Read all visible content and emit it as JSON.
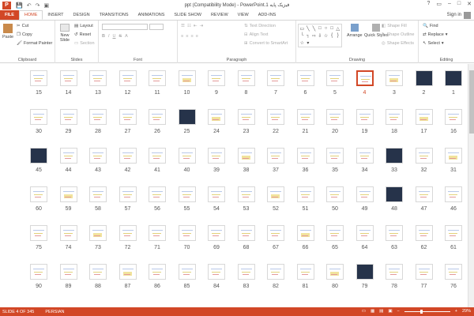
{
  "titlebar": {
    "app_icon": "P",
    "title": "ppt (Compatibility Mode) - PowerPoint.فیزیک پایه 1",
    "qat_icons": [
      "save-icon",
      "undo-icon",
      "redo-icon",
      "slideshow-icon"
    ],
    "controls": [
      "?",
      "▭",
      "–",
      "□",
      "✕"
    ]
  },
  "tabs": [
    "FILE",
    "HOME",
    "INSERT",
    "DESIGN",
    "TRANSITIONS",
    "ANIMATIONS",
    "SLIDE SHOW",
    "REVIEW",
    "VIEW",
    "ADD-INS"
  ],
  "active_tab": "HOME",
  "signin": "Sign in",
  "ribbon": {
    "clipboard": {
      "label": "Clipboard",
      "paste": "Paste",
      "cut": "Cut",
      "copy": "Copy",
      "format_painter": "Format Painter"
    },
    "slides": {
      "label": "Slides",
      "new_slide": "New Slide",
      "layout": "Layout",
      "reset": "Reset",
      "section": "Section"
    },
    "font": {
      "label": "Font"
    },
    "paragraph": {
      "label": "Paragraph",
      "text_direction": "Text Direction",
      "align_text": "Align Text",
      "convert_smartart": "Convert to SmartArt"
    },
    "drawing": {
      "label": "Drawing",
      "arrange": "Arrange",
      "quick_styles": "Quick Styles",
      "shape_fill": "Shape Fill",
      "shape_outline": "Shape Outline",
      "shape_effects": "Shape Effects"
    },
    "editing": {
      "label": "Editing",
      "find": "Find",
      "replace": "Replace",
      "select": "Select"
    }
  },
  "slides": {
    "selected": 4,
    "rows": [
      [
        "15",
        "14",
        "13",
        "12",
        "11",
        "10",
        "9",
        "8",
        "7",
        "6",
        "5",
        "4",
        "3",
        "2",
        "1"
      ],
      [
        "30",
        "29",
        "28",
        "27",
        "26",
        "25",
        "24",
        "23",
        "22",
        "21",
        "20",
        "19",
        "18",
        "17",
        "16"
      ],
      [
        "45",
        "44",
        "43",
        "42",
        "41",
        "40",
        "39",
        "38",
        "37",
        "36",
        "35",
        "34",
        "33",
        "32",
        "31"
      ],
      [
        "60",
        "59",
        "58",
        "57",
        "56",
        "55",
        "54",
        "53",
        "52",
        "51",
        "50",
        "49",
        "48",
        "47",
        "46"
      ],
      [
        "75",
        "74",
        "73",
        "72",
        "71",
        "70",
        "69",
        "68",
        "67",
        "66",
        "65",
        "64",
        "63",
        "62",
        "61"
      ],
      [
        "90",
        "89",
        "88",
        "87",
        "86",
        "85",
        "84",
        "83",
        "82",
        "81",
        "80",
        "79",
        "78",
        "77",
        "76"
      ]
    ],
    "dark_slides": [
      "2",
      "1",
      "45",
      "25",
      "79",
      "48",
      "33"
    ]
  },
  "status": {
    "slide": "SLIDE 4 OF 345",
    "language": "PERSIAN",
    "zoom": "29%"
  },
  "colors": {
    "accent": "#d24726"
  }
}
